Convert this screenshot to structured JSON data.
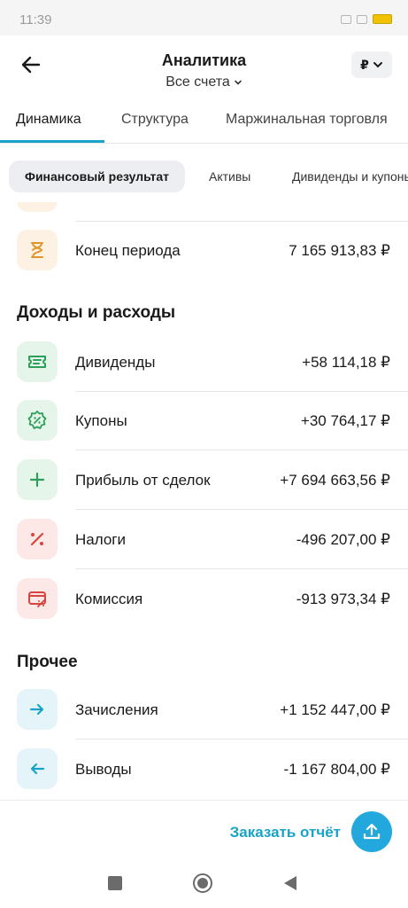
{
  "statusbar": {
    "time": "11:39"
  },
  "header": {
    "title": "Аналитика",
    "subtitle": "Все счета",
    "currency": "₽"
  },
  "tabs": [
    {
      "label": "Динамика",
      "active": true
    },
    {
      "label": "Структура",
      "active": false
    },
    {
      "label": "Маржинальная торговля",
      "active": false
    }
  ],
  "chips": [
    {
      "label": "Финансовый результат",
      "active": true
    },
    {
      "label": "Активы",
      "active": false
    },
    {
      "label": "Дивиденды и купоны",
      "active": false
    }
  ],
  "summary": {
    "end_period": {
      "label": "Конец периода",
      "value": "7 165 913,83 ₽",
      "icon": "hourglass-icon"
    }
  },
  "income_section": {
    "title": "Доходы и расходы",
    "items": [
      {
        "label": "Дивиденды",
        "value": "+58 114,18 ₽",
        "icon": "ticket-icon"
      },
      {
        "label": "Купоны",
        "value": "+30 764,17 ₽",
        "icon": "percent-badge-icon"
      },
      {
        "label": "Прибыль от сделок",
        "value": "+7 694 663,56 ₽",
        "icon": "plus-icon"
      },
      {
        "label": "Налоги",
        "value": "-496 207,00 ₽",
        "icon": "percent-icon"
      },
      {
        "label": "Комиссия",
        "value": "-913 973,34 ₽",
        "icon": "card-percent-icon"
      }
    ]
  },
  "other_section": {
    "title": "Прочее",
    "items": [
      {
        "label": "Зачисления",
        "value": "+1 152 447,00 ₽",
        "icon": "arrow-right-icon"
      },
      {
        "label": "Выводы",
        "value": "-1 167 804,00 ₽",
        "icon": "arrow-left-icon"
      }
    ]
  },
  "footer": {
    "order_report": "Заказать отчёт"
  },
  "colors": {
    "accent": "#1aa3c9",
    "button": "#22a8dc",
    "green": "#2e9e5b",
    "red": "#d8453e",
    "orange": "#e89a2c"
  }
}
